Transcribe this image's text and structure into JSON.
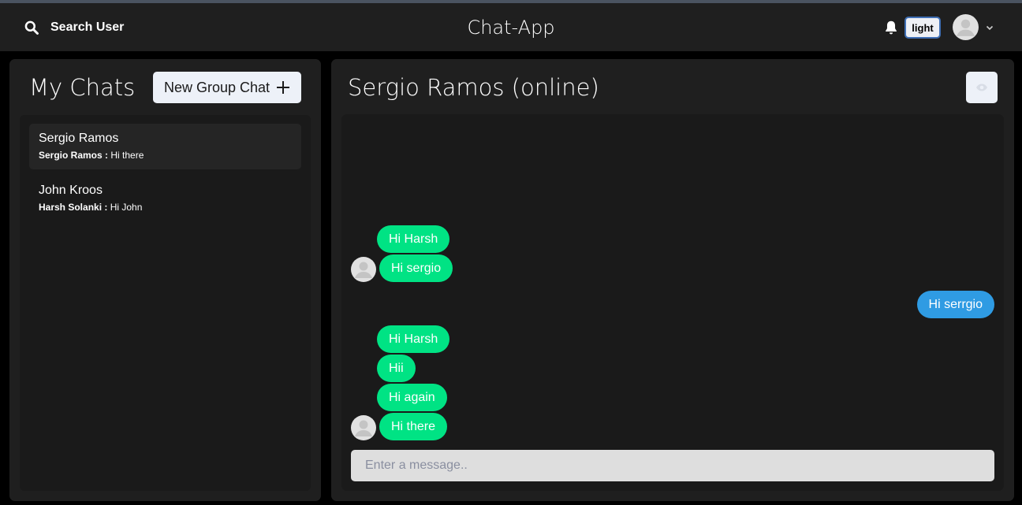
{
  "header": {
    "search_label": "Search User",
    "app_title": "Chat-App",
    "theme_label": "light",
    "icons": {
      "search": "search-icon",
      "bell": "bell-icon",
      "avatar": "user-avatar",
      "chevron": "chevron-down-icon"
    }
  },
  "sidebar": {
    "title": "My Chats",
    "new_group_label": "New Group Chat",
    "chats": [
      {
        "name": "Sergio Ramos",
        "sender": "Sergio Ramos :",
        "message": "Hi there",
        "active": true
      },
      {
        "name": "John Kroos",
        "sender": "Harsh Solanki :",
        "message": "Hi John",
        "active": false
      }
    ]
  },
  "conversation": {
    "title": "Sergio Ramos (online)",
    "messages": [
      {
        "text": "Hi Harsh",
        "from": "other"
      },
      {
        "text": "Hi sergio",
        "from": "other"
      },
      {
        "text": "Hi serrgio",
        "from": "me"
      },
      {
        "text": "Hi Harsh",
        "from": "other"
      },
      {
        "text": "Hii",
        "from": "other"
      },
      {
        "text": "Hi again",
        "from": "other"
      },
      {
        "text": "Hi there",
        "from": "other"
      }
    ],
    "input_placeholder": "Enter a message.."
  },
  "colors": {
    "background": "#000000",
    "panel": "#1f1f1f",
    "incoming_bubble": "#00e384",
    "outgoing_bubble": "#2f9be3"
  }
}
